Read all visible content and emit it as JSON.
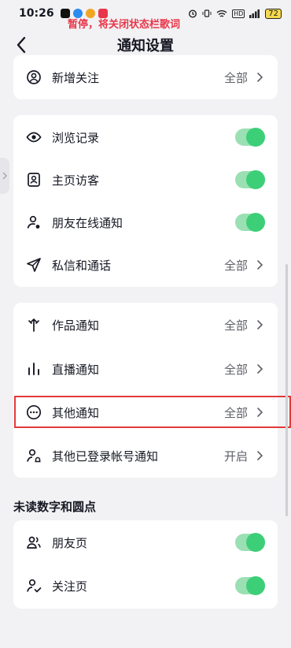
{
  "status_bar": {
    "time": "10:26",
    "network_badge": "HD",
    "battery": "72",
    "lyric_notice": "暂停，将关闭状态栏歌词"
  },
  "nav": {
    "title": "通知设置"
  },
  "group1": {
    "items": [
      {
        "label": "新增关注",
        "value": "全部",
        "icon": "person-circle-icon"
      }
    ]
  },
  "group2": {
    "items": [
      {
        "label": "浏览记录",
        "control": "toggle",
        "on": true,
        "icon": "eye-icon"
      },
      {
        "label": "主页访客",
        "control": "toggle",
        "on": true,
        "icon": "profile-card-icon"
      },
      {
        "label": "朋友在线通知",
        "control": "toggle",
        "on": true,
        "icon": "person-dot-icon"
      },
      {
        "label": "私信和通话",
        "value": "全部",
        "icon": "paper-plane-icon"
      }
    ]
  },
  "group3": {
    "items": [
      {
        "label": "作品通知",
        "value": "全部",
        "icon": "sparkle-icon"
      },
      {
        "label": "直播通知",
        "value": "全部",
        "icon": "bars-icon"
      },
      {
        "label": "其他通知",
        "value": "全部",
        "icon": "more-circle-icon"
      },
      {
        "label": "其他已登录帐号通知",
        "value": "开启",
        "icon": "person-bell-icon"
      }
    ]
  },
  "unread_section": {
    "title": "未读数字和圆点",
    "items": [
      {
        "label": "朋友页",
        "control": "toggle",
        "on": true,
        "icon": "people-icon"
      },
      {
        "label": "关注页",
        "control": "toggle",
        "on": true,
        "icon": "person-check-icon"
      }
    ]
  },
  "colors": {
    "toggle_on": "#3ccf78",
    "toggle_track": "#9be0b3",
    "highlight": "#e23a3a",
    "lyric": "#e8374a"
  }
}
